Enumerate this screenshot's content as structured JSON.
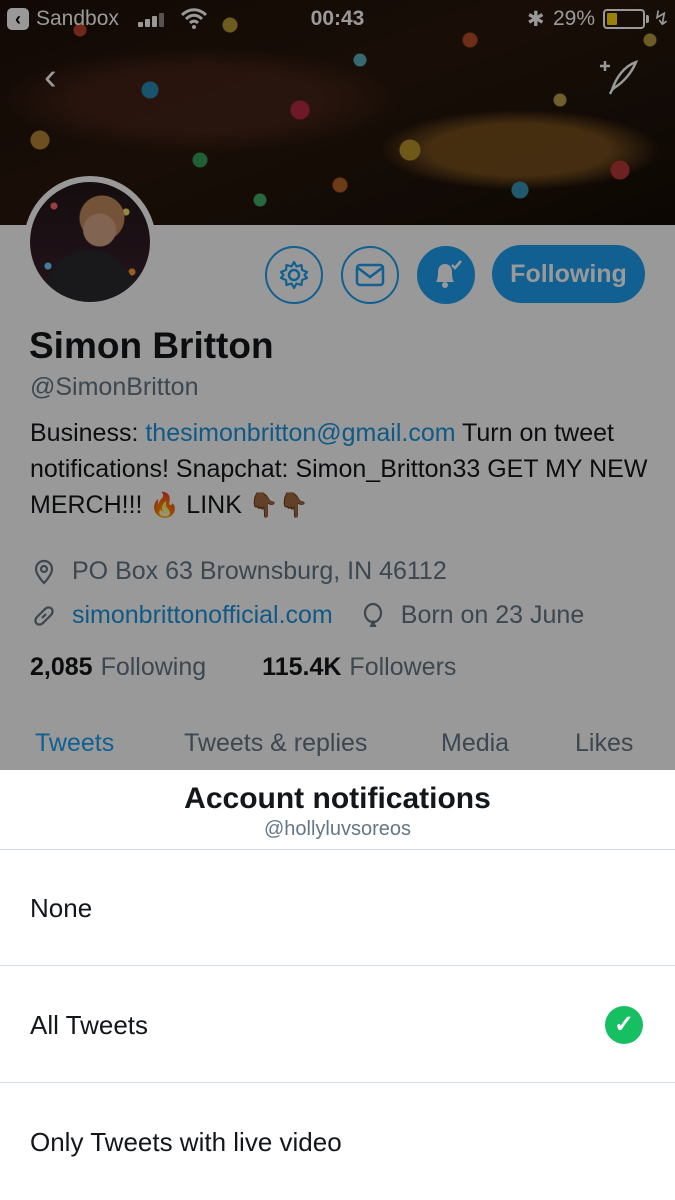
{
  "status_bar": {
    "back_app": "Sandbox",
    "time": "00:43",
    "battery": "29%",
    "battery_level": 0.29
  },
  "nav": {
    "back_icon": "chevron-left-icon",
    "compose_icon": "compose-tweet-icon"
  },
  "profile": {
    "name": "Simon Britton",
    "handle": "@SimonBritton",
    "bio": {
      "part1": "Business: ",
      "email": "thesimonbritton@gmail.com",
      "part2": " Turn on tweet notifications! Snapchat: Simon_Britton33 GET MY NEW MERCH!!! ",
      "fire_emoji": "🔥",
      "part3": " LINK ",
      "point_emoji": "👇🏾👇🏾"
    },
    "location": "PO Box 63 Brownsburg, IN 46112",
    "website": "simonbrittonofficial.com",
    "birthday": "Born on 23 June",
    "following_count": "2,085",
    "following_label": "Following",
    "followers_count": "115.4K",
    "followers_label": "Followers",
    "follow_button": "Following"
  },
  "tabs": [
    {
      "label": "Tweets",
      "active": true
    },
    {
      "label": "Tweets & replies",
      "active": false
    },
    {
      "label": "Media",
      "active": false
    },
    {
      "label": "Likes",
      "active": false
    }
  ],
  "sheet": {
    "title": "Account notifications",
    "subtitle": "@hollyluvsoreos",
    "options": [
      {
        "label": "None",
        "selected": false
      },
      {
        "label": "All Tweets",
        "selected": true
      },
      {
        "label": "Only Tweets with live video",
        "selected": false
      }
    ],
    "check_glyph": "✓"
  },
  "colors": {
    "accent": "#1da1f2",
    "link": "#1b95e0",
    "check": "#17bf63",
    "battery": "#ffd60a"
  }
}
